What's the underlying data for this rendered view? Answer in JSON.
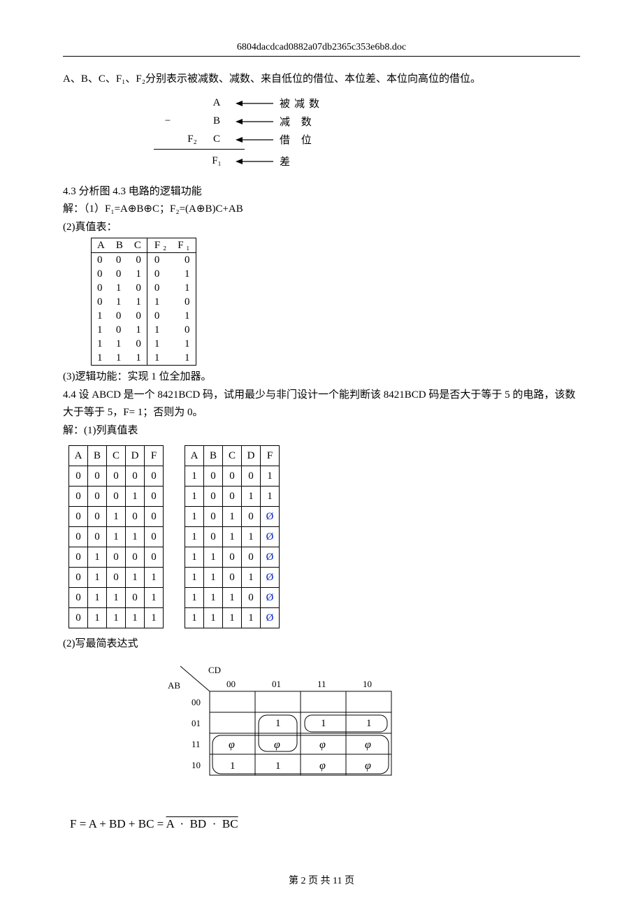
{
  "header": {
    "filename": "6804dacdcad0882a07db2365c353e6b8.doc"
  },
  "intro": "A、B、C、F₁、F₂分别表示被减数、减数、来自低位的借位、本位差、本位向高位的借位。",
  "subtraction": {
    "row1": {
      "main": "A",
      "label": "被减数"
    },
    "row2": {
      "sign": "−",
      "main": "B",
      "label": "减 数"
    },
    "row3": {
      "f2": "F₂",
      "main": "C",
      "label": "借 位"
    },
    "row4": {
      "main": "F₁",
      "label": "差"
    }
  },
  "sec43": {
    "title": "4.3 分析图 4.3 电路的逻辑功能",
    "eq": "解：（1）F₁=A⊕B⊕C；F₂=(A⊕B)C+AB",
    "sub2": "(2)真值表：",
    "table": {
      "head": [
        "A",
        "B",
        "C",
        "F ₂",
        "F ₁"
      ],
      "rows": [
        [
          "0",
          "0",
          "0",
          "0",
          "0"
        ],
        [
          "0",
          "0",
          "1",
          "0",
          "1"
        ],
        [
          "0",
          "1",
          "0",
          "0",
          "1"
        ],
        [
          "0",
          "1",
          "1",
          "1",
          "0"
        ],
        [
          "1",
          "0",
          "0",
          "0",
          "1"
        ],
        [
          "1",
          "0",
          "1",
          "1",
          "0"
        ],
        [
          "1",
          "1",
          "0",
          "1",
          "1"
        ],
        [
          "1",
          "1",
          "1",
          "1",
          "1"
        ]
      ]
    },
    "func": "(3)逻辑功能：实现 1 位全加器。"
  },
  "sec44": {
    "title": "4.4 设 ABCD 是一个 8421BCD 码，试用最少与非门设计一个能判断该 8421BCD 码是否大于等于 5 的电路，该数大于等于 5，F= 1；否则为 0。",
    "sub1": "解：(1)列真值表",
    "tableL": {
      "head": [
        "A",
        "B",
        "C",
        "D",
        "F"
      ],
      "rows": [
        [
          "0",
          "0",
          "0",
          "0",
          "0"
        ],
        [
          "0",
          "0",
          "0",
          "1",
          "0"
        ],
        [
          "0",
          "0",
          "1",
          "0",
          "0"
        ],
        [
          "0",
          "0",
          "1",
          "1",
          "0"
        ],
        [
          "0",
          "1",
          "0",
          "0",
          "0"
        ],
        [
          "0",
          "1",
          "0",
          "1",
          "1"
        ],
        [
          "0",
          "1",
          "1",
          "0",
          "1"
        ],
        [
          "0",
          "1",
          "1",
          "1",
          "1"
        ]
      ]
    },
    "tableR": {
      "head": [
        "A",
        "B",
        "C",
        "D",
        "F"
      ],
      "rows": [
        [
          "1",
          "0",
          "0",
          "0",
          "1"
        ],
        [
          "1",
          "0",
          "0",
          "1",
          "1"
        ],
        [
          "1",
          "0",
          "1",
          "0",
          "Ø"
        ],
        [
          "1",
          "0",
          "1",
          "1",
          "Ø"
        ],
        [
          "1",
          "1",
          "0",
          "0",
          "Ø"
        ],
        [
          "1",
          "1",
          "0",
          "1",
          "Ø"
        ],
        [
          "1",
          "1",
          "1",
          "0",
          "Ø"
        ],
        [
          "1",
          "1",
          "1",
          "1",
          "Ø"
        ]
      ]
    },
    "sub2": "(2)写最简表达式",
    "kmap": {
      "col_label": "CD",
      "row_label": "AB",
      "cols": [
        "00",
        "01",
        "11",
        "10"
      ],
      "rows": [
        "00",
        "01",
        "11",
        "10"
      ],
      "cells": [
        [
          "",
          "",
          "",
          ""
        ],
        [
          "",
          "1",
          "1",
          "1"
        ],
        [
          "φ",
          "φ",
          "φ",
          "φ"
        ],
        [
          "1",
          "1",
          "φ",
          "φ"
        ]
      ]
    },
    "formula_plain": "F = A + BD + BC = ",
    "formula_bar_outer": "A · BD · BC",
    "formula_bar_inner_a": "A",
    "formula_bar_inner_bd": "BD",
    "formula_bar_inner_bc": "BC"
  },
  "footer": {
    "text_a": "第 ",
    "page": "2",
    "text_b": " 页 共 ",
    "total": "11",
    "text_c": " 页"
  }
}
